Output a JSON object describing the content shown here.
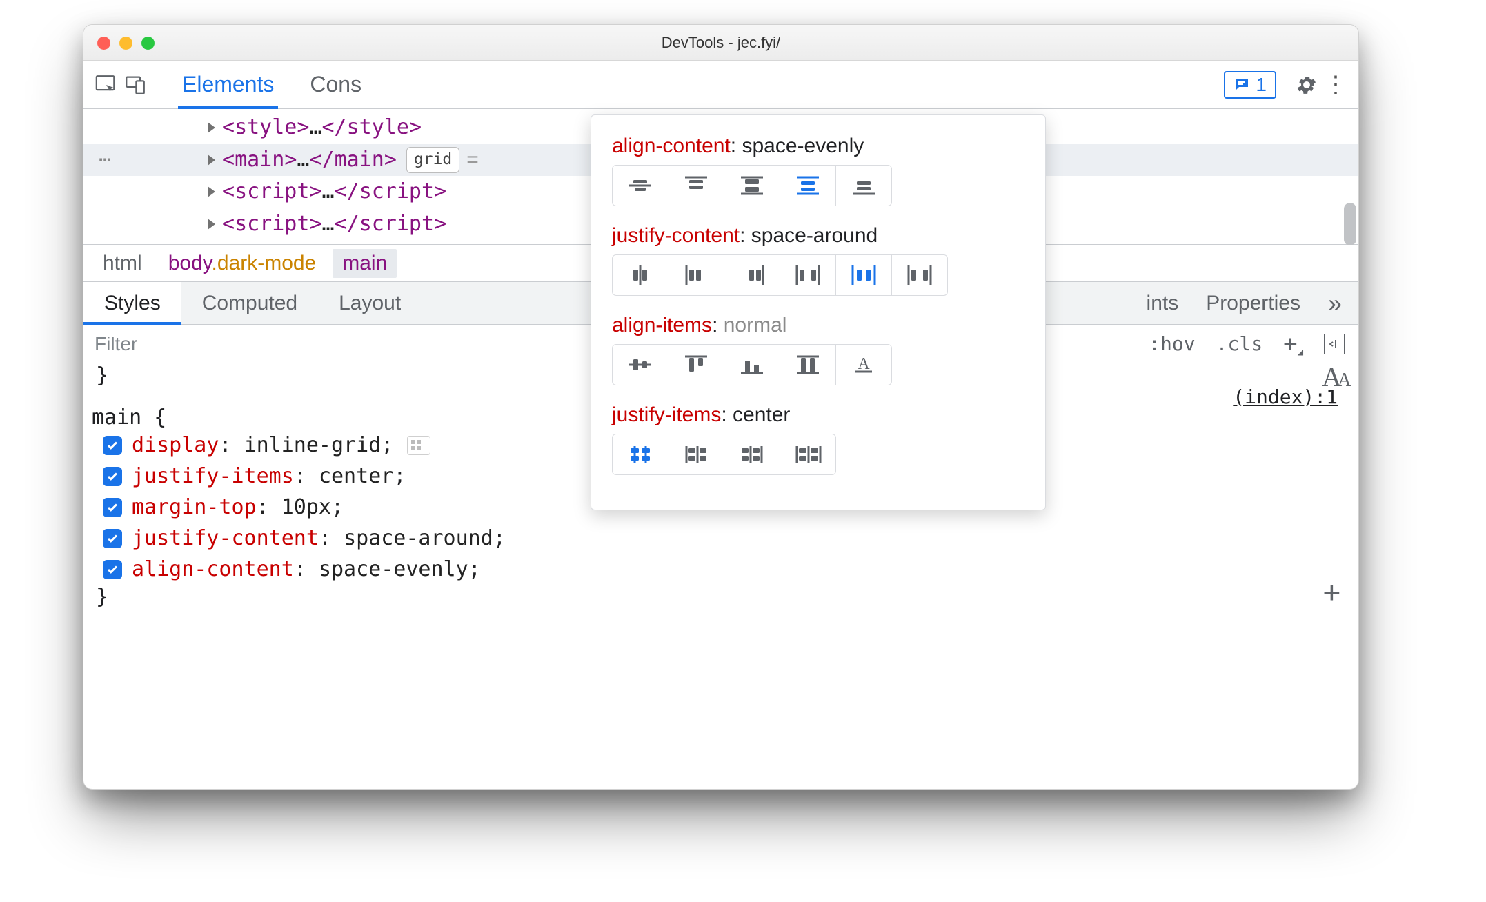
{
  "window": {
    "title": "DevTools - jec.fyi/"
  },
  "toolbar": {
    "tabs": {
      "elements": "Elements",
      "console": "Cons"
    },
    "issues_count": "1"
  },
  "dom": {
    "rows": [
      {
        "tag": "style",
        "selected": false
      },
      {
        "tag": "main",
        "selected": true,
        "badge": "grid"
      },
      {
        "tag": "script",
        "selected": false
      },
      {
        "tag": "script",
        "selected": false
      }
    ]
  },
  "crumbs": {
    "items": [
      {
        "text": "html"
      },
      {
        "text_parts": {
          "tag": "body",
          "sel": ".dark-mode"
        }
      },
      {
        "text": "main",
        "active": true
      }
    ]
  },
  "subtabs": {
    "styles": "Styles",
    "computed": "Computed",
    "layout": "Layout",
    "hidden_right": "ints",
    "properties": "Properties"
  },
  "filter": {
    "placeholder": "Filter",
    "hov": ":hov",
    "cls": ".cls"
  },
  "rule": {
    "selector": "main",
    "source": "(index):1",
    "decls": [
      {
        "prop": "display",
        "val": "inline-grid",
        "editorBtn": true
      },
      {
        "prop": "justify-items",
        "val": "center"
      },
      {
        "prop": "margin-top",
        "val": "10px"
      },
      {
        "prop": "justify-content",
        "val": "space-around"
      },
      {
        "prop": "align-content",
        "val": "space-evenly"
      }
    ]
  },
  "popover": {
    "groups": [
      {
        "key": "align-content",
        "value": "space-evenly",
        "muted": false,
        "icons": 5,
        "active": 3,
        "set": "ac"
      },
      {
        "key": "justify-content",
        "value": "space-around",
        "muted": false,
        "icons": 6,
        "active": 4,
        "set": "jc"
      },
      {
        "key": "align-items",
        "value": "normal",
        "muted": true,
        "icons": 5,
        "active": -1,
        "set": "ai"
      },
      {
        "key": "justify-items",
        "value": "center",
        "muted": false,
        "icons": 4,
        "active": 0,
        "set": "ji"
      }
    ]
  }
}
